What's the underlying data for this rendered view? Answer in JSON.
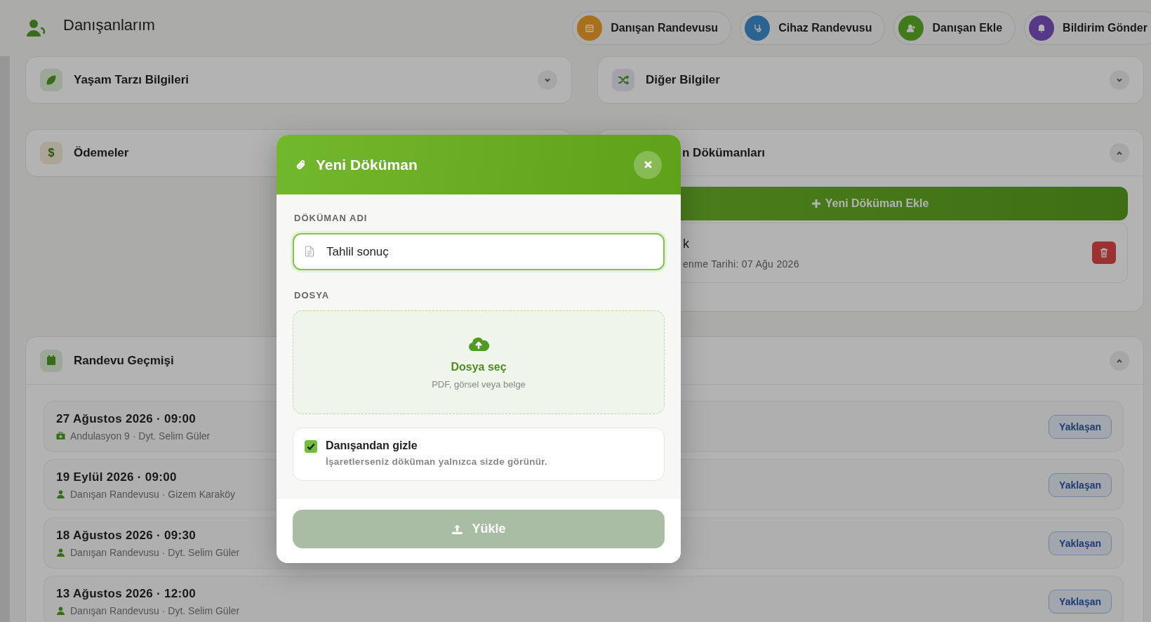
{
  "header": {
    "title": "Danışanlarım",
    "actions": [
      {
        "label": "Danışan Randevusu",
        "color": "#a8701d"
      },
      {
        "label": "Cihaz Randevusu",
        "color": "#2b6491"
      },
      {
        "label": "Danışan Ekle",
        "color": "#407a1d"
      },
      {
        "label": "Bildirim Gönder",
        "color": "#553886"
      }
    ]
  },
  "sections": [
    {
      "title": "Yaşam Tarzı Bilgileri",
      "expanded": false
    },
    {
      "title": "Diğer Bilgiler",
      "expanded": false
    },
    {
      "title": "Ödemeler",
      "glyph": "$"
    },
    {
      "title": "n Dökümanları",
      "expanded": true,
      "add_button": "Yeni Döküman Ekle",
      "documents": [
        {
          "title": "k",
          "meta": "enme Tarihi: 07 Ağu 2026"
        }
      ]
    }
  ],
  "appointments": {
    "title": "Randevu Geçmişi",
    "expanded": true,
    "items": [
      {
        "datetime": "27 Ağustos 2026 · 09:00",
        "kind": "device",
        "detail": "Andulasyon 9 · Dyt. Selim Güler",
        "status": "Yaklaşan"
      },
      {
        "datetime": "19 Eylül 2026 · 09:00",
        "kind": "client",
        "detail": "Danışan Randevusu · Gizem Karaköy",
        "status": "Yaklaşan"
      },
      {
        "datetime": "18 Ağustos 2026 · 09:30",
        "kind": "client",
        "detail": "Danışan Randevusu · Dyt. Selim Güler",
        "status": "Yaklaşan"
      },
      {
        "datetime": "13 Ağustos 2026 · 12:00",
        "kind": "client",
        "detail": "Danışan Randevusu · Dyt. Selim Güler",
        "status": "Yaklaşan"
      }
    ]
  },
  "modal": {
    "title": "Yeni Döküman",
    "name_label": "DÖKÜMAN ADI",
    "name_value": "Tahlil sonuç",
    "file_label": "DOSYA",
    "drop_title": "Dosya seç",
    "drop_hint": "PDF, görsel veya belge",
    "hide": {
      "label": "Danışandan gizle",
      "hint": "İşaretlerseniz döküman yalnızca sizde görünür.",
      "checked": true
    },
    "submit": {
      "label": "Yükle",
      "disabled": true
    }
  }
}
